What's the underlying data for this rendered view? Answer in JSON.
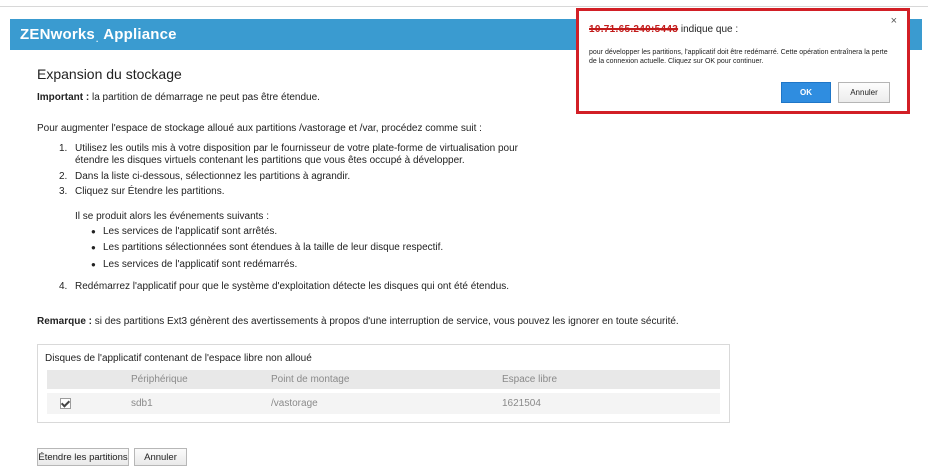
{
  "header": {
    "brand": "ZENworks",
    "brand_reg": ".",
    "product": "Appliance"
  },
  "page": {
    "title": "Expansion du stockage",
    "important_label": "Important :",
    "important_text": " la partition de démarrage ne peut pas être étendue.",
    "intro": "Pour augmenter l'espace de stockage alloué aux partitions /vastorage et /var, procédez comme suit :",
    "steps": [
      {
        "num": "1.",
        "line1": "Utilisez les outils mis à votre disposition par le fournisseur de votre plate-forme de virtualisation pour",
        "line2": "étendre les disques virtuels contenant les partitions que vous êtes occupé à développer."
      },
      {
        "num": "2.",
        "line1": "Dans la liste ci-dessous, sélectionnez les partitions à agrandir."
      },
      {
        "num": "3.",
        "line1": "Cliquez sur Étendre les partitions."
      },
      {
        "num": "4.",
        "line1": "Redémarrez l'applicatif pour que le système d'exploitation détecte les disques qui ont été étendus."
      }
    ],
    "events_intro": "Il se produit alors les événements suivants :",
    "events": [
      "Les services de l'applicatif sont arrêtés.",
      "Les partitions sélectionnées sont étendues à la taille de leur disque respectif.",
      "Les services de l'applicatif sont redémarrés."
    ],
    "note_label": "Remarque :",
    "note_text": " si des partitions Ext3 génèrent des avertissements à propos d'une interruption de service, vous pouvez les ignorer en toute sécurité."
  },
  "disks_panel": {
    "title": "Disques de l'applicatif contenant de l'espace libre non alloué",
    "columns": [
      "Périphérique",
      "Point de montage",
      "Espace libre"
    ],
    "rows": [
      {
        "checked": true,
        "device": "sdb1",
        "mount": "/vastorage",
        "free": "1621504"
      }
    ]
  },
  "buttons": {
    "expand": "Étendre les partitions",
    "cancel": "Annuler"
  },
  "dialog": {
    "origin": "10.71.65.240:5443",
    "says": " indique que :",
    "message": "pour développer les partitions, l'applicatif doit être redémarré. Cette opération entraînera la perte de la connexion actuelle. Cliquez sur OK pour continuer.",
    "ok": "OK",
    "cancel": "Annuler",
    "close_icon": "×"
  }
}
